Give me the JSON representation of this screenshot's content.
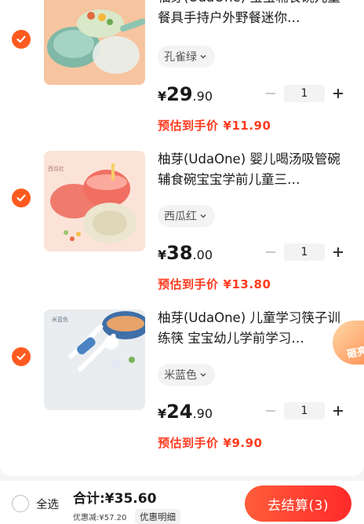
{
  "items": [
    {
      "title": "柚芽(UdaOne) 宝宝辅食碗儿童餐具手持户外野餐迷你…",
      "spec": "孔雀绿",
      "price_currency": "¥",
      "price_int": "29",
      "price_dec": ".90",
      "qty": "1",
      "est_label": "预估到手价",
      "est_price": "¥11.90",
      "checked": true
    },
    {
      "title": "柚芽(UdaOne) 婴儿喝汤吸管碗辅食碗宝宝学前儿童三…",
      "spec": "西瓜红",
      "thumb_caption": "西瓜红",
      "price_currency": "¥",
      "price_int": "38",
      "price_dec": ".00",
      "qty": "1",
      "est_label": "预估到手价",
      "est_price": "¥13.80",
      "checked": true
    },
    {
      "title": "柚芽(UdaOne) 儿童学习筷子训练筷 宝宝幼儿学前学习…",
      "spec": "米蓝色",
      "thumb_caption": "米蓝色",
      "price_currency": "¥",
      "price_int": "24",
      "price_dec": ".90",
      "qty": "1",
      "est_label": "预估到手价",
      "est_price": "¥9.90",
      "checked": true
    }
  ],
  "side_badge": "砸亮",
  "footer": {
    "select_all": "全选",
    "total": "合计:¥35.60",
    "discount": "优惠减:¥57.20",
    "detail": "优惠明细",
    "checkout": "去结算(3)"
  },
  "colors": {
    "accent": "#ff5a1f",
    "price_red": "#ff3b1f",
    "checkout_from": "#ff5d3a",
    "checkout_to": "#ff2a2a"
  },
  "icons": [
    "check-icon",
    "chevron-down-icon",
    "minus-icon",
    "plus-icon"
  ]
}
